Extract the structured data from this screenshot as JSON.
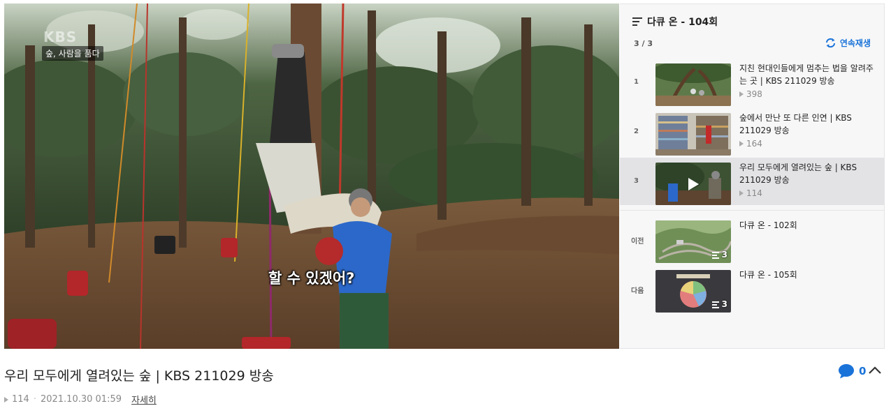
{
  "player": {
    "channel_logo": "KBS",
    "overlay_caption": "숲, 사람을 품다",
    "subtitle": "할 수 있겠어?"
  },
  "playlist": {
    "title": "다큐 온 - 104회",
    "position": "3 / 3",
    "autoplay_label": "연속재생",
    "items": [
      {
        "index": "1",
        "title": "지친 현대인들에게 멈추는 법을 알려주는 곳 | KBS 211029 방송",
        "views": "398"
      },
      {
        "index": "2",
        "title": "숲에서 만난 또 다른 인연 | KBS 211029 방송",
        "views": "164"
      },
      {
        "index": "3",
        "title": "우리 모두에게 열려있는 숲 | KBS 211029 방송",
        "views": "114"
      }
    ],
    "prev": {
      "label": "이전",
      "title": "다큐 온 - 102회",
      "count": "3"
    },
    "next": {
      "label": "다음",
      "title": "다큐 온 - 105회",
      "count": "3"
    }
  },
  "video": {
    "title": "우리 모두에게 열려있는 숲 | KBS 211029 방송",
    "views": "114",
    "date": "2021.10.30 01:59",
    "detail_label": "자세히",
    "comment_count": "0"
  },
  "colors": {
    "accent": "#1a73d9",
    "active_row": "#e3e3e6",
    "panel_bg": "#f7f7f8"
  }
}
